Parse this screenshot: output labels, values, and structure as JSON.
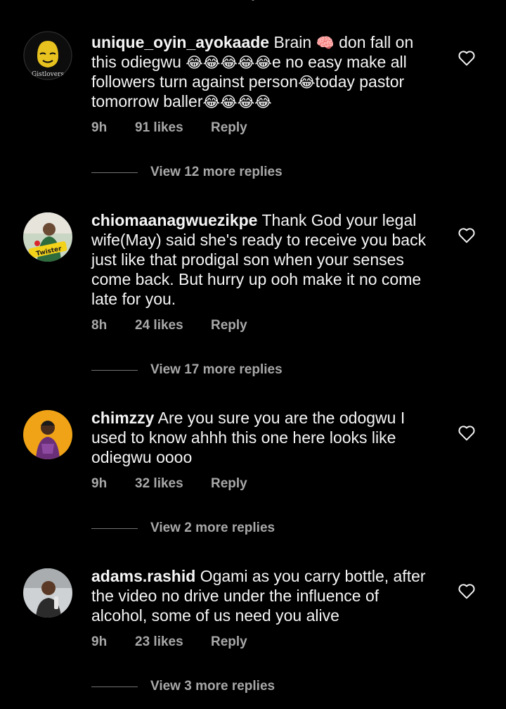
{
  "comments": [
    {
      "username": "unique_oyin_ayokaade",
      "avatar_text": "Gistlovers",
      "lines": [
        [
          {
            "t": "Brain "
          },
          {
            "e": "🧠"
          },
          {
            "t": " don fall on"
          }
        ],
        [
          {
            "t": "this odiegwu "
          },
          {
            "e": "😂😂😂😂😂"
          },
          {
            "t": "e no easy make all"
          }
        ],
        [
          {
            "t": "followers turn against person"
          },
          {
            "e": "😂"
          },
          {
            "t": "today pastor"
          }
        ],
        [
          {
            "t": "tomorrow baller"
          },
          {
            "e": "😂😂😂😂"
          }
        ]
      ],
      "time": "9h",
      "likes": "91 likes",
      "reply": "Reply",
      "view_replies": "View 12 more replies"
    },
    {
      "username": "chiomaanagwuezikpe",
      "avatar_text": "Twister",
      "lines": [
        [
          {
            "t": "Thank God your legal"
          }
        ],
        [
          {
            "t": "wife(May) said she's ready to receive you back"
          }
        ],
        [
          {
            "t": "just like that prodigal son when your senses"
          }
        ],
        [
          {
            "t": "come back. But hurry up ooh make it no come"
          }
        ],
        [
          {
            "t": "late for you."
          }
        ]
      ],
      "time": "8h",
      "likes": "24 likes",
      "reply": "Reply",
      "view_replies": "View 17 more replies"
    },
    {
      "username": "chimzzy",
      "avatar_text": "",
      "lines": [
        [
          {
            "t": "Are you sure you are the odogwu I"
          }
        ],
        [
          {
            "t": "used to know ahhh this one here looks like"
          }
        ],
        [
          {
            "t": "odiegwu oooo"
          }
        ]
      ],
      "time": "9h",
      "likes": "32 likes",
      "reply": "Reply",
      "view_replies": "View 2 more replies"
    },
    {
      "username": "adams.rashid",
      "avatar_text": "",
      "lines": [
        [
          {
            "t": "Ogami as you carry bottle, after"
          }
        ],
        [
          {
            "t": "the video no drive under the influence of"
          }
        ],
        [
          {
            "t": "alcohol, some of us need you alive"
          }
        ]
      ],
      "time": "9h",
      "likes": "23 likes",
      "reply": "Reply",
      "view_replies": "View 3 more replies"
    }
  ],
  "icons": {
    "heart": "heart-outline-icon"
  },
  "colors": {
    "background": "#000000",
    "text": "#f5f5f5",
    "secondary": "#a8a8a8"
  }
}
